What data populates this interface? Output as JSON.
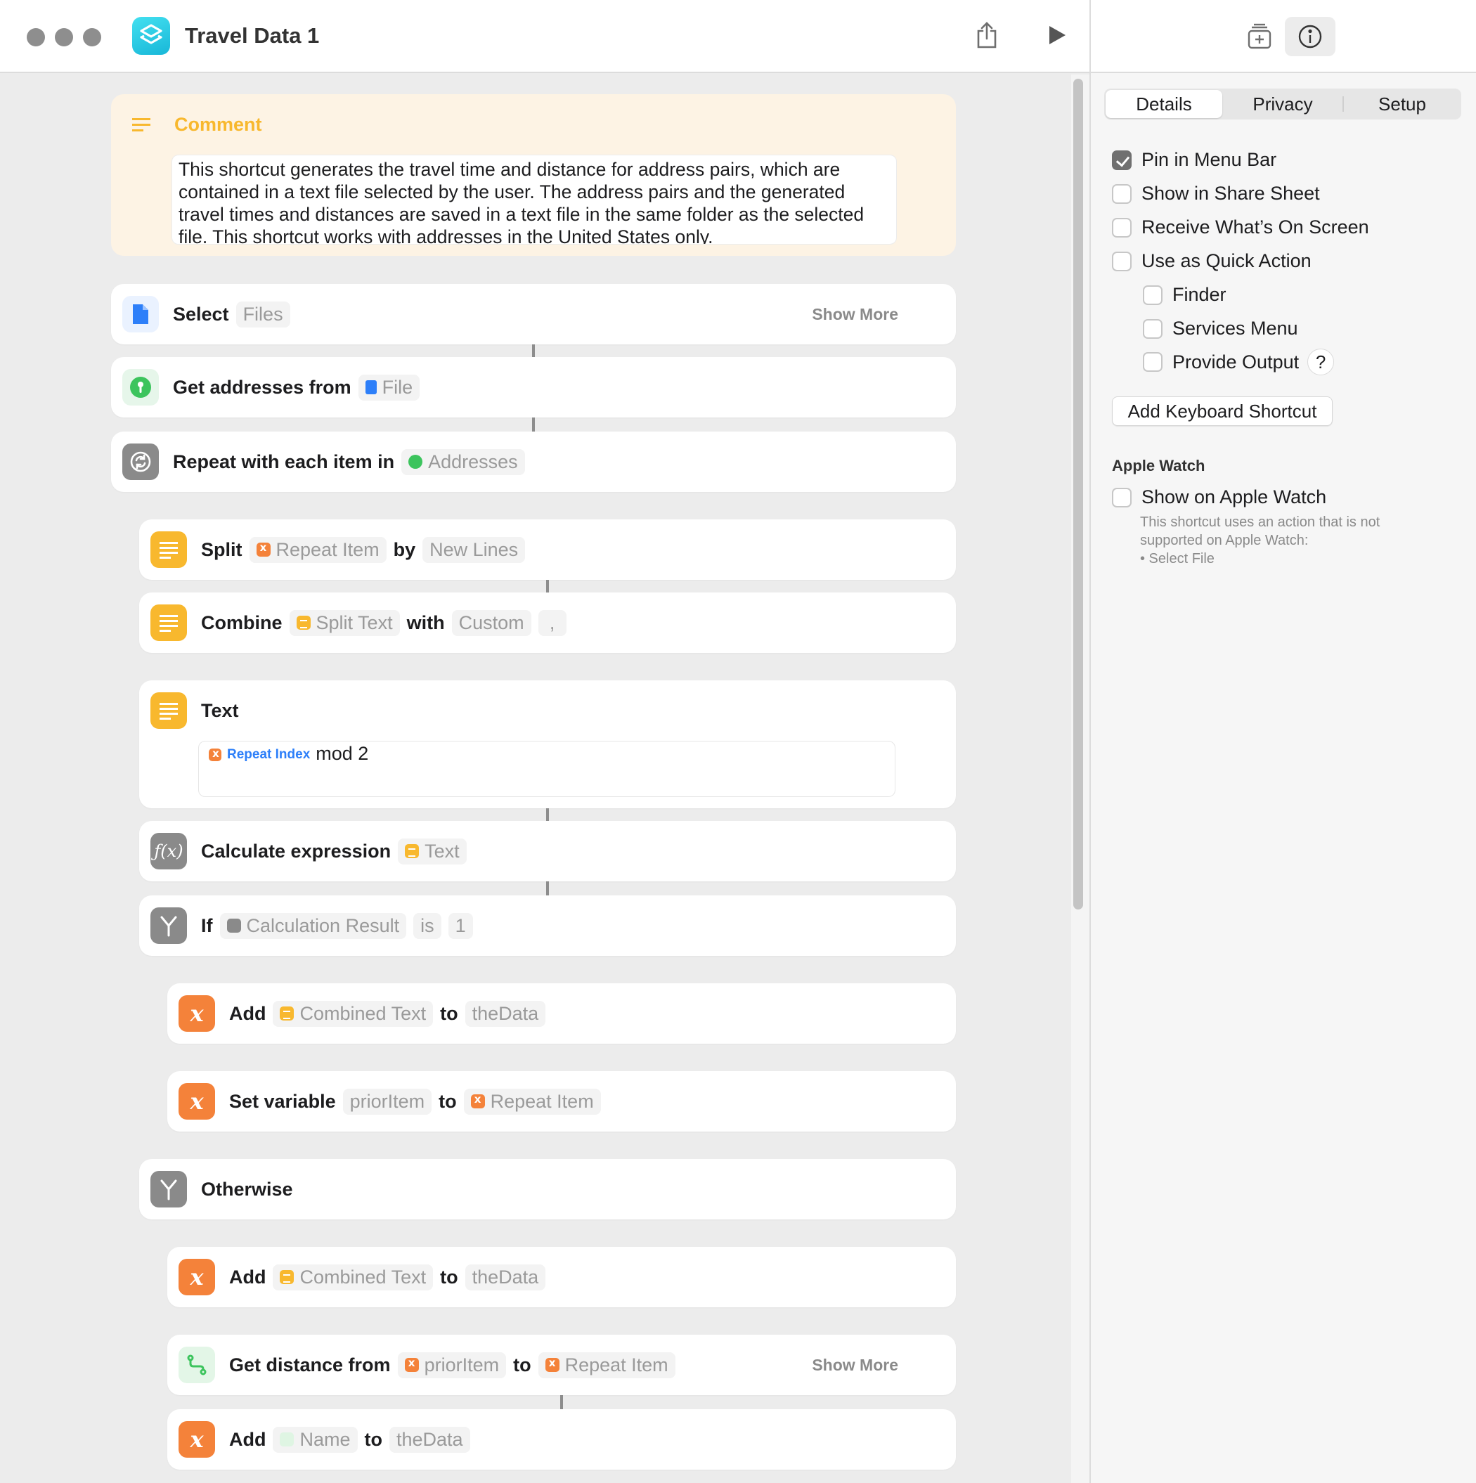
{
  "window": {
    "title": "Travel Data 1"
  },
  "comment": {
    "label": "Comment",
    "text": "This shortcut generates the travel time and distance for address pairs, which are contained in a text file selected by the user. The address pairs and the generated travel times and distances are saved in a text file in the same folder as the selected file. This shortcut works with addresses in the United States only."
  },
  "actions": {
    "select": {
      "verb": "Select",
      "param": "Files",
      "show_more": "Show More"
    },
    "get_addresses": {
      "verb": "Get addresses from",
      "param": "File"
    },
    "repeat": {
      "verb": "Repeat with each item in",
      "param": "Addresses"
    },
    "split": {
      "verb": "Split",
      "param": "Repeat Item",
      "by": "by",
      "by_param": "New Lines"
    },
    "combine": {
      "verb": "Combine",
      "param": "Split Text",
      "with": "with",
      "with_param": "Custom",
      "custom_value": ","
    },
    "text": {
      "verb": "Text",
      "variable": "Repeat Index",
      "suffix": "mod 2"
    },
    "calculate": {
      "verb": "Calculate expression",
      "param": "Text"
    },
    "if": {
      "verb": "If",
      "param": "Calculation Result",
      "op": "is",
      "value": "1"
    },
    "add1": {
      "verb": "Add",
      "param": "Combined Text",
      "to": "to",
      "target": "theData"
    },
    "set_variable": {
      "verb": "Set variable",
      "name": "priorItem",
      "to": "to",
      "value": "Repeat Item"
    },
    "otherwise": {
      "verb": "Otherwise"
    },
    "add2": {
      "verb": "Add",
      "param": "Combined Text",
      "to": "to",
      "target": "theData"
    },
    "get_distance": {
      "verb": "Get distance from",
      "param": "priorItem",
      "to": "to",
      "target": "Repeat Item",
      "show_more": "Show More"
    },
    "add3": {
      "verb": "Add",
      "param": "Name",
      "to": "to",
      "target": "theData"
    }
  },
  "sidebar": {
    "tabs": [
      "Details",
      "Privacy",
      "Setup"
    ],
    "options": [
      {
        "label": "Pin in Menu Bar",
        "checked": true
      },
      {
        "label": "Show in Share Sheet",
        "checked": false
      },
      {
        "label": "Receive What’s On Screen",
        "checked": false
      },
      {
        "label": "Use as Quick Action",
        "checked": false
      },
      {
        "label": "Finder",
        "checked": false
      },
      {
        "label": "Services Menu",
        "checked": false
      },
      {
        "label": "Provide Output",
        "checked": false
      }
    ],
    "help": "?",
    "keyboard_button": "Add Keyboard Shortcut",
    "apple_watch": {
      "heading": "Apple Watch",
      "option": "Show on Apple Watch",
      "note_line1": "This shortcut uses an action that is not",
      "note_line2": "supported on Apple Watch:",
      "note_line3": "• Select File"
    }
  },
  "colors": {
    "comment_bg": "#fdf3e4",
    "comment_accent": "#f8b82e",
    "orange": "#f4823a",
    "yellow": "#f8b82e",
    "gray": "#8a8a8a",
    "accent_blue": "#2d7ff9"
  }
}
